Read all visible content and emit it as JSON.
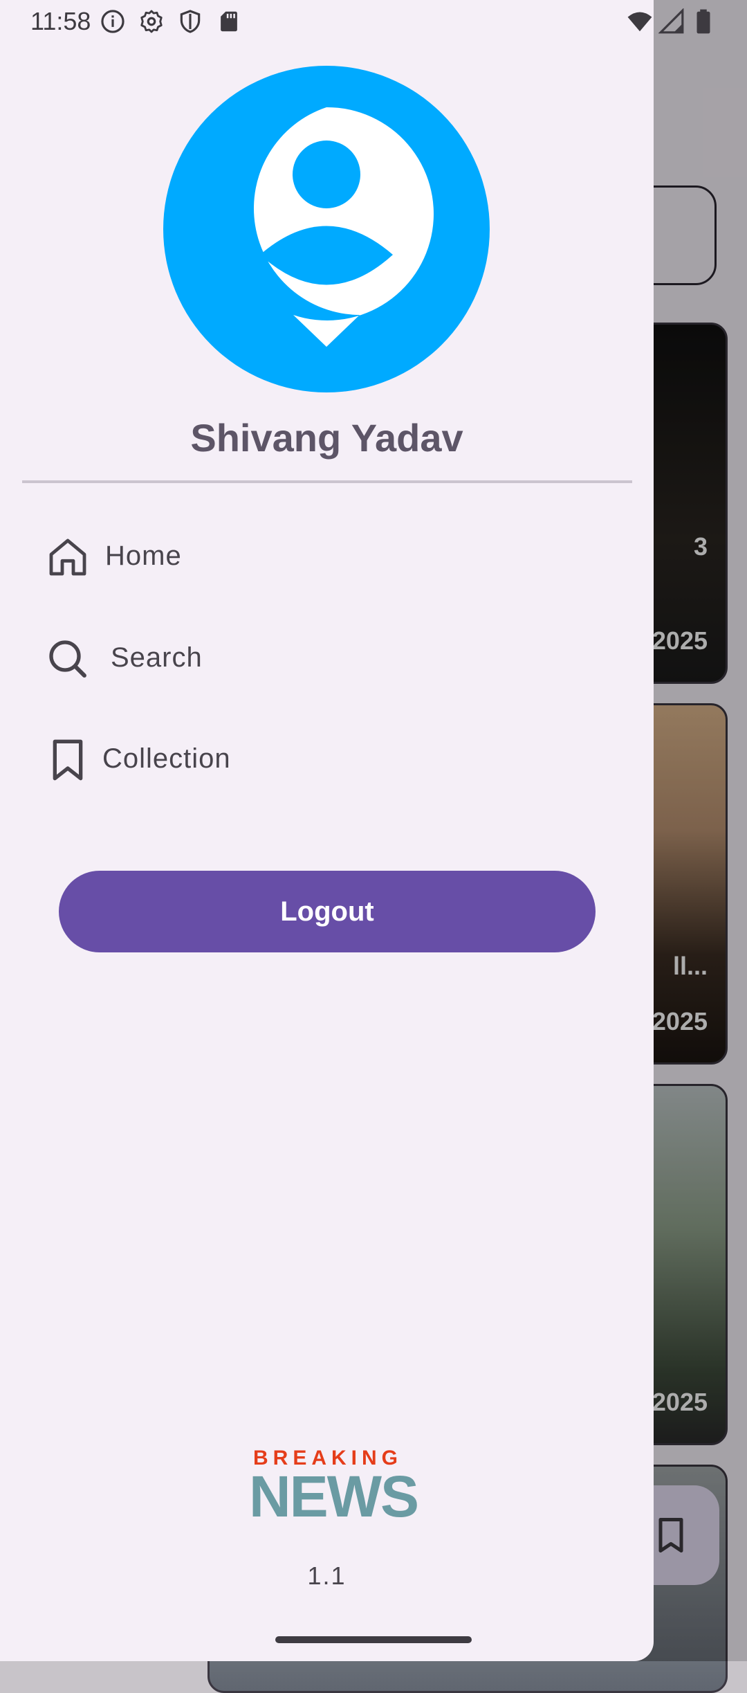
{
  "status_bar": {
    "time": "11:58",
    "left_icons": [
      "info-icon",
      "settings-icon",
      "shield-icon",
      "sd-card-icon"
    ],
    "right_icons": [
      "wifi-icon",
      "signal-icon",
      "battery-icon"
    ]
  },
  "background": {
    "cards": [
      {
        "partial_text": "3"
      },
      {
        "partial_text": "2025"
      },
      {
        "partial_text": "ll..."
      },
      {
        "partial_text": "2025"
      },
      {
        "partial_text": "2025"
      }
    ],
    "fab_icon": "bookmark-icon"
  },
  "drawer": {
    "user_name": "Shivang Yadav",
    "nav_items": [
      {
        "label": "Home",
        "icon": "home-icon"
      },
      {
        "label": "Search",
        "icon": "search-icon"
      },
      {
        "label": "Collection",
        "icon": "bookmark-icon"
      }
    ],
    "logout_label": "Logout",
    "brand": {
      "top": "BREAKING",
      "bottom": "NEWS"
    },
    "version": "1.1"
  },
  "colors": {
    "avatar_blue": "#00aaff",
    "logout_purple": "#674ea7",
    "drawer_bg": "#f5eff7",
    "brand_red": "#e53d1a",
    "brand_teal": "#6a9ba3"
  }
}
